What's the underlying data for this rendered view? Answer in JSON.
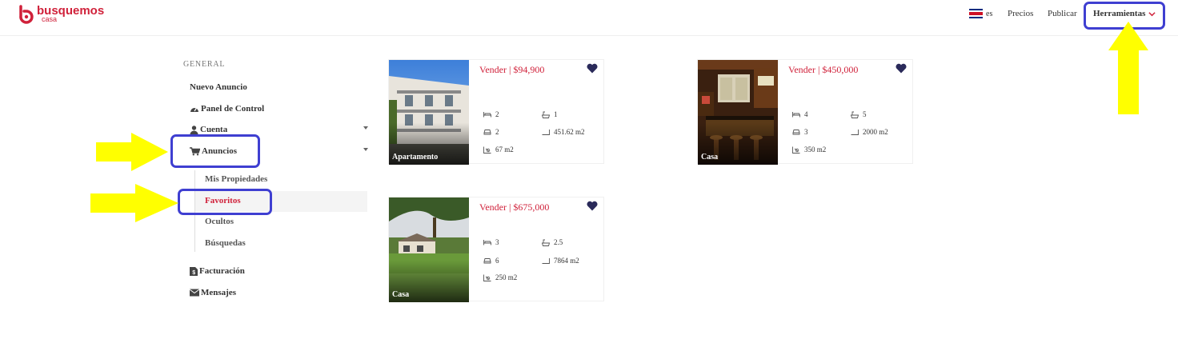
{
  "header": {
    "logo_name": "busquemos",
    "logo_sub": "casa",
    "language": "es",
    "nav": {
      "precios": "Precios",
      "publicar": "Publicar",
      "herramientas": "Herramientas"
    }
  },
  "sidebar": {
    "heading": "GENERAL",
    "items": {
      "nuevo_anuncio": "Nuevo Anuncio",
      "panel_control": "Panel de Control",
      "cuenta": "Cuenta",
      "anuncios": "Anuncios",
      "facturacion": "Facturación",
      "mensajes": "Mensajes"
    },
    "sub_items": {
      "mis_propiedades": "Mis Propiedades",
      "favoritos": "Favoritos",
      "ocultos": "Ocultos",
      "busquedas": "Búsquedas"
    }
  },
  "listings": [
    {
      "price": "Vender | $94,900",
      "type": "Apartamento",
      "bedrooms": "2",
      "bathrooms": "1",
      "parking": "2",
      "lot": "451.62 m2",
      "construction": "67 m2"
    },
    {
      "price": "Vender | $450,000",
      "type": "Casa",
      "bedrooms": "4",
      "bathrooms": "5",
      "parking": "3",
      "lot": "2000 m2",
      "construction": "350 m2"
    },
    {
      "price": "Vender | $675,000",
      "type": "Casa",
      "bedrooms": "3",
      "bathrooms": "2.5",
      "parking": "6",
      "lot": "7864 m2",
      "construction": "250 m2"
    }
  ],
  "colors": {
    "brand_red": "#d0213a",
    "annotation_blue": "#3f3fd1",
    "annotation_yellow": "#ffff00",
    "heart": "#2a2a5a"
  }
}
